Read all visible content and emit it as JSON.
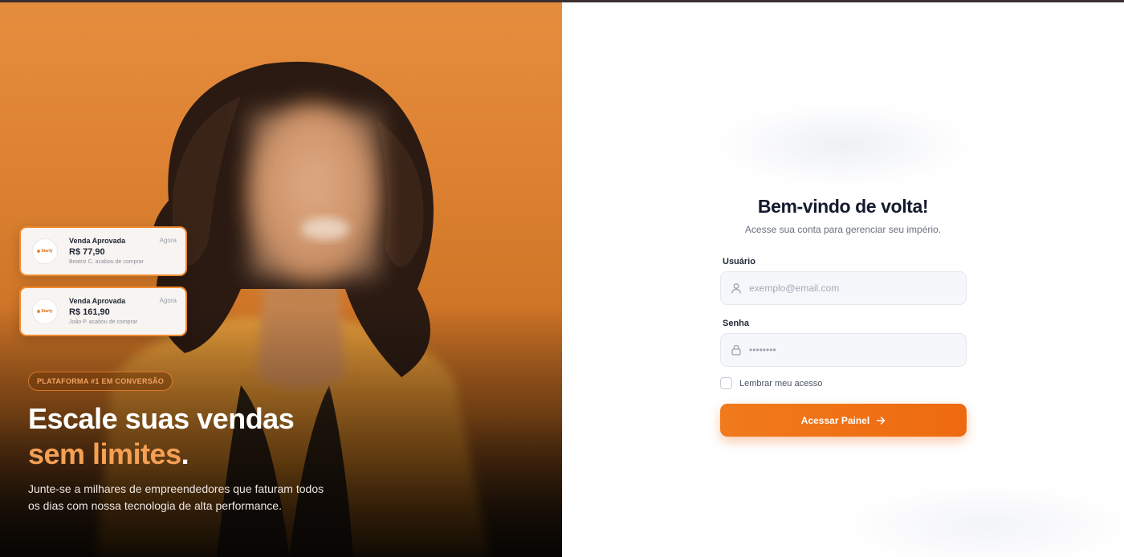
{
  "colors": {
    "accent": "#ee6a10",
    "accent_light": "#f5a055",
    "hero_top": "#e58d3e",
    "heading": "#141a2e"
  },
  "notifications": [
    {
      "title": "Venda Aprovada",
      "time": "Agora",
      "amount": "R$ 77,90",
      "detail": "Beatriz C. acabou de comprar",
      "logo_text": "Starfy",
      "logo_icon": "brand-logo-icon"
    },
    {
      "title": "Venda Aprovada",
      "time": "Agora",
      "amount": "R$ 161,90",
      "detail": "João P. acabou de comprar",
      "logo_text": "Starfy",
      "logo_icon": "brand-logo-icon"
    }
  ],
  "hero": {
    "badge": "PLATAFORMA #1 EM CONVERSÃO",
    "headline_line1": "Escale suas vendas",
    "headline_accent": "sem limites",
    "headline_period": ".",
    "subtitle": "Junte-se a milhares de empreendedores que faturam todos os dias com nossa tecnologia de alta performance."
  },
  "login": {
    "title": "Bem-vindo de volta!",
    "subtitle": "Acesse sua conta para gerenciar seu império.",
    "username_label": "Usuário",
    "username_placeholder": "exemplo@email.com",
    "username_icon": "user-icon",
    "password_label": "Senha",
    "password_value": "••••••••",
    "password_icon": "lock-icon",
    "remember_label": "Lembrar meu acesso",
    "remember_checked": false,
    "submit_label": "Acessar Painel",
    "submit_icon": "arrow-right-icon"
  }
}
